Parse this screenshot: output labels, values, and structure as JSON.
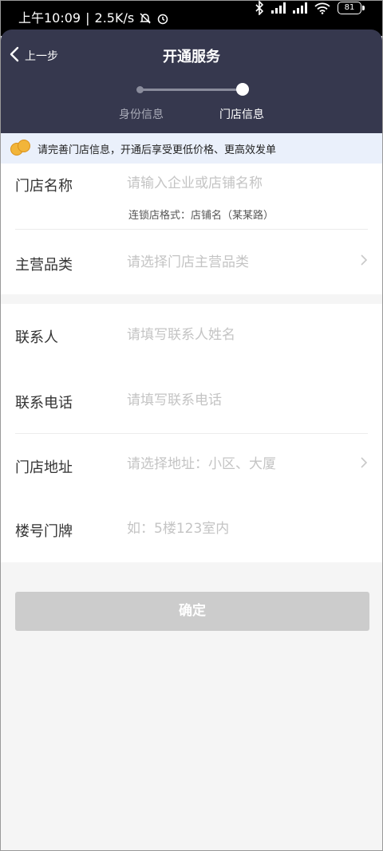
{
  "status_bar": {
    "time": "上午10:09",
    "speed": "2.5K/s",
    "battery": "81"
  },
  "header": {
    "back_label": "上一步",
    "title": "开通服务",
    "steps": [
      {
        "label": "身份信息",
        "active": false
      },
      {
        "label": "门店信息",
        "active": true
      }
    ]
  },
  "notice": {
    "text": "请完善门店信息，开通后享受更低价格、更高效发单"
  },
  "form": {
    "store_name": {
      "label": "门店名称",
      "placeholder": "请输入企业或店铺名称",
      "hint": "连锁店格式：店铺名（某某路）"
    },
    "category": {
      "label": "主营品类",
      "placeholder": "请选择门店主营品类"
    },
    "contact": {
      "label": "联系人",
      "placeholder": "请填写联系人姓名"
    },
    "phone": {
      "label": "联系电话",
      "placeholder": "请填写联系电话"
    },
    "address": {
      "label": "门店地址",
      "placeholder": "请选择地址：小区、大厦"
    },
    "unit": {
      "label": "楼号门牌",
      "placeholder": "如：5楼123室内"
    }
  },
  "confirm_label": "确定",
  "colors": {
    "header_bg": "#36384e",
    "notice_bg": "#eaf0fb",
    "button_disabled": "#cccccc"
  }
}
